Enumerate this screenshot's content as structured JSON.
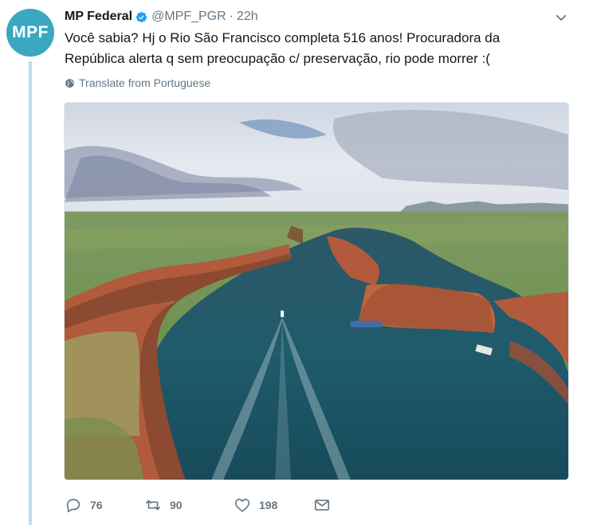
{
  "tweet": {
    "avatar_text": "MPF",
    "display_name": "MP Federal",
    "handle": "@MPF_PGR",
    "separator": "·",
    "time": "22h",
    "text": "Você sabia? Hj o Rio São Francisco completa 516 anos! Procuradora da República alerta q sem preocupação c/ preservação, rio pode morrer :(",
    "translate_label": "Translate from Portuguese",
    "reply_count": "76",
    "retweet_count": "90",
    "like_count": "198"
  },
  "colors": {
    "avatar": "#3aa8c1",
    "verified": "#1da1f2",
    "thread_line": "#b8e0f4",
    "muted": "#657786",
    "text": "#14171a"
  },
  "icons": {
    "verified": "verified-badge-icon",
    "caret": "chevron-down-icon",
    "translate": "globe-icon",
    "reply": "reply-icon",
    "retweet": "retweet-icon",
    "like": "heart-icon",
    "message": "envelope-icon"
  }
}
